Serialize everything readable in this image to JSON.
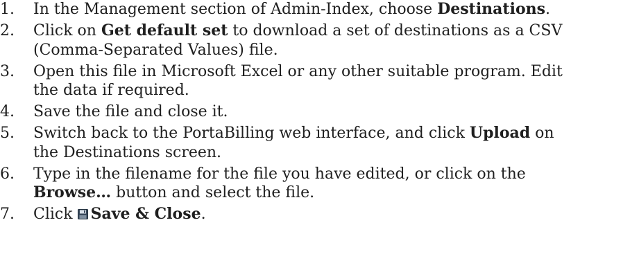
{
  "steps": [
    {
      "number": "1.",
      "t1": "In the Management section of Admin-Index, choose ",
      "b1": "Destinations",
      "t2": "."
    },
    {
      "number": "2.",
      "t1": "Click on ",
      "b1": "Get default set",
      "t2": " to download a set of destinations as a CSV",
      "t3": "(Comma-Separated Values) file."
    },
    {
      "number": "3.",
      "t1": "Open this file in Microsoft Excel or any other suitable program. Edit",
      "t2": "the data if required."
    },
    {
      "number": "4.",
      "t1": "Save the file and close it."
    },
    {
      "number": "5.",
      "t1": "Switch back to the PortaBilling web interface, and click ",
      "b1": "Upload",
      "t2": " on",
      "t3": "the Destinations screen."
    },
    {
      "number": "6.",
      "t1": "Type in the filename for the file you have edited, or click on the",
      "b1": "Browse…",
      "t2": " button and select the file."
    },
    {
      "number": "7.",
      "t1": "Click ",
      "icon": "save-icon",
      "b1": "Save & Close",
      "t2": "."
    }
  ]
}
